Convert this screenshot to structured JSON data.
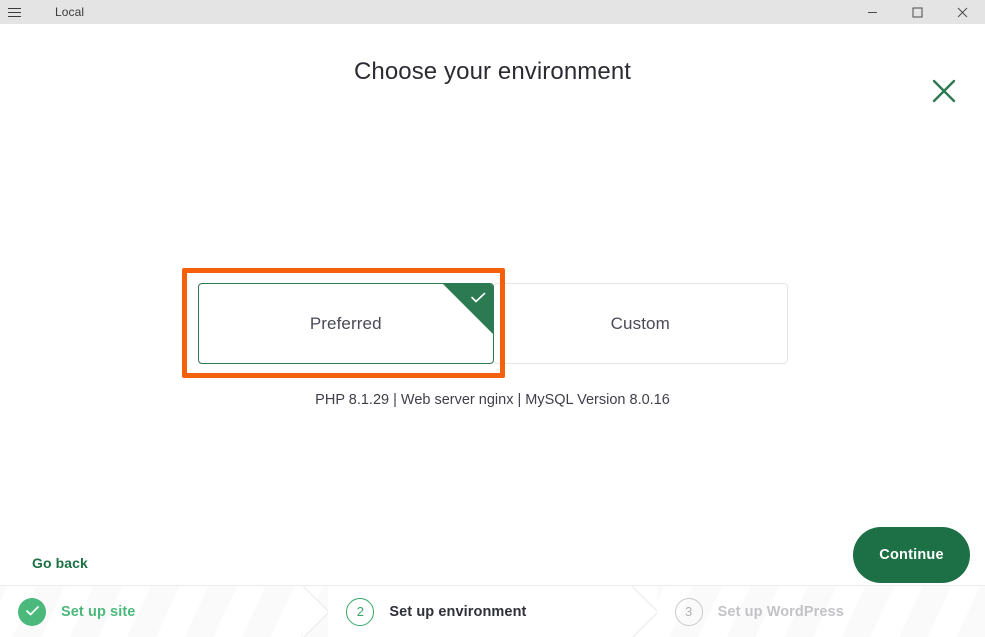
{
  "window": {
    "title": "Local",
    "menu_icon": "hamburger-icon",
    "controls": {
      "minimize": "minimize-icon",
      "maximize": "maximize-icon",
      "close": "close-icon"
    }
  },
  "page": {
    "title": "Choose your environment",
    "close_icon": "close-x-icon",
    "accent_green": "#1d7045",
    "highlight_orange": "#f4610a"
  },
  "environment": {
    "options": [
      {
        "label": "Preferred",
        "selected": true,
        "check_icon": "check-icon"
      },
      {
        "label": "Custom",
        "selected": false
      }
    ],
    "details": "PHP 8.1.29 | Web server nginx | MySQL Version 8.0.16"
  },
  "actions": {
    "go_back": "Go back",
    "continue": "Continue"
  },
  "stepper": {
    "steps": [
      {
        "number": "1",
        "label": "Set up site",
        "state": "done",
        "icon": "check-icon"
      },
      {
        "number": "2",
        "label": "Set up environment",
        "state": "active"
      },
      {
        "number": "3",
        "label": "Set up WordPress",
        "state": "todo"
      }
    ]
  }
}
